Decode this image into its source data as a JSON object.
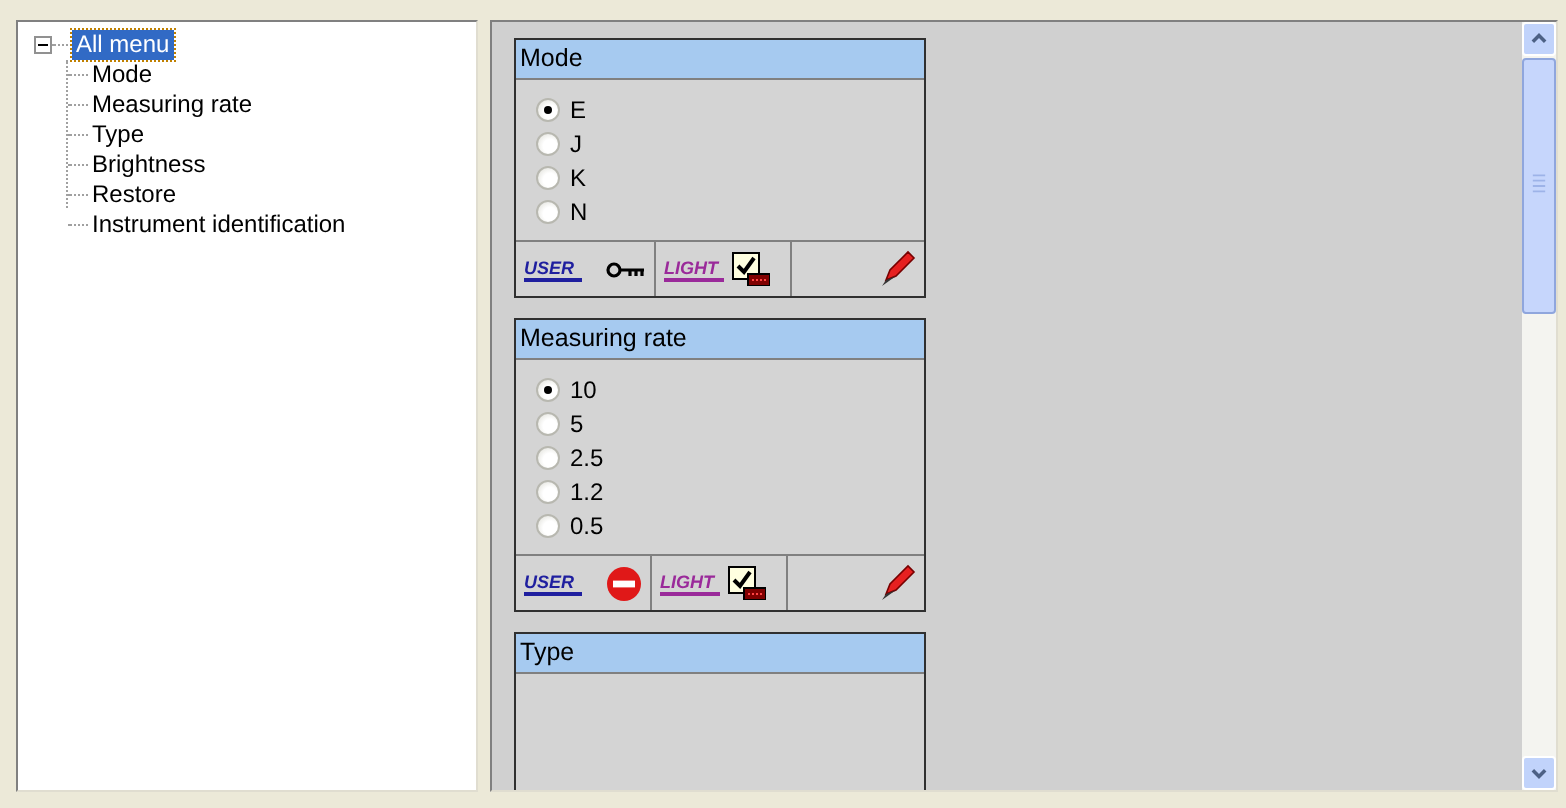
{
  "tree": {
    "label": "All menu",
    "selected": true,
    "expanded": true,
    "children": [
      {
        "label": "Mode",
        "selected": false
      },
      {
        "label": "Measuring rate",
        "selected": false
      },
      {
        "label": "Type",
        "selected": false
      },
      {
        "label": "Brightness",
        "selected": false
      },
      {
        "label": "Restore",
        "selected": false
      },
      {
        "label": "Instrument identification",
        "selected": false
      }
    ]
  },
  "panels": [
    {
      "title": "Mode",
      "options": [
        {
          "label": "E",
          "selected": true
        },
        {
          "label": "J",
          "selected": false
        },
        {
          "label": "K",
          "selected": false
        },
        {
          "label": "N",
          "selected": false
        }
      ],
      "footer": {
        "user_label": "USER",
        "user_icon": {
          "kind": "key"
        },
        "light_label": "LIGHT"
      }
    },
    {
      "title": "Measuring rate",
      "options": [
        {
          "label": "10",
          "selected": true
        },
        {
          "label": "5",
          "selected": false
        },
        {
          "label": "2.5",
          "selected": false
        },
        {
          "label": "1.2",
          "selected": false
        },
        {
          "label": "0.5",
          "selected": false
        }
      ],
      "footer": {
        "user_label": "USER",
        "user_icon": {
          "kind": "blocked"
        },
        "light_label": "LIGHT"
      }
    },
    {
      "title": "Type"
    }
  ]
}
